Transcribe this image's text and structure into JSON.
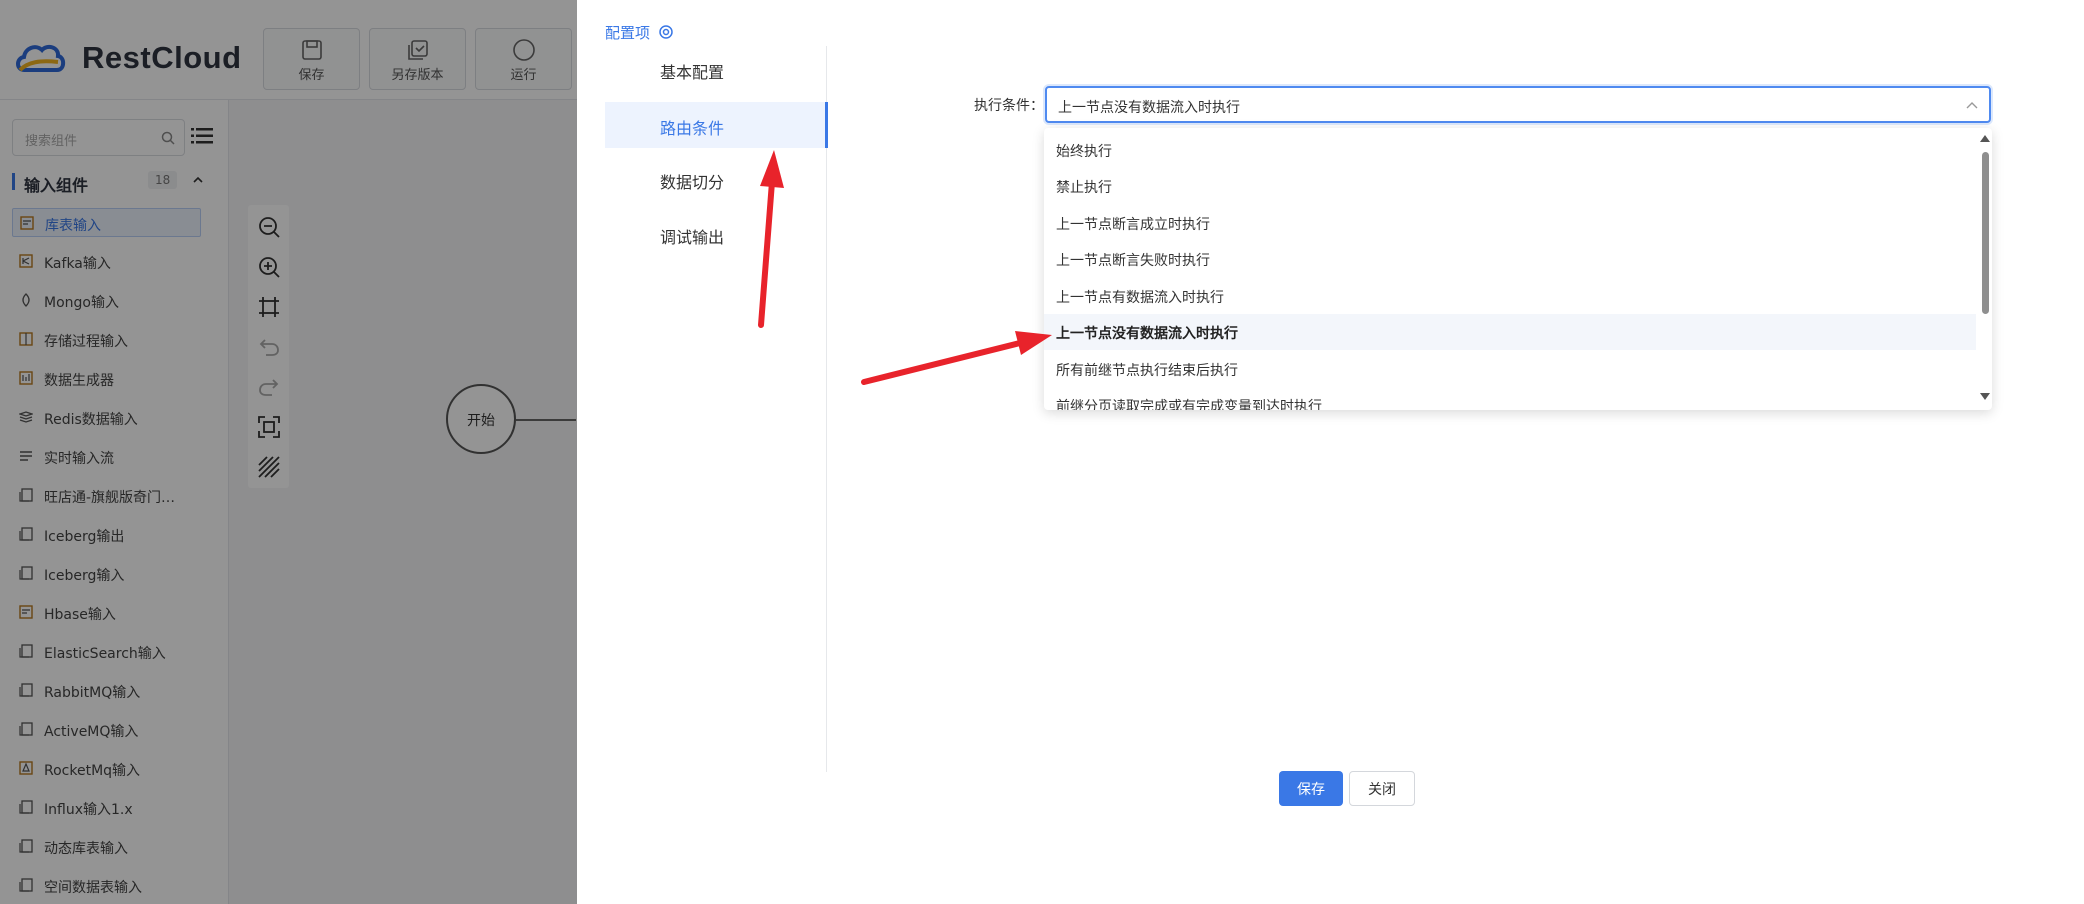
{
  "app": {
    "brand": "RestCloud",
    "toolbar": [
      {
        "label": "保存",
        "icon": "save-icon"
      },
      {
        "label": "另存版本",
        "icon": "save-version-icon"
      },
      {
        "label": "运行",
        "icon": "run-icon"
      }
    ],
    "search_placeholder": "搜索组件",
    "group": {
      "title": "输入组件",
      "count": "18"
    },
    "components": [
      "库表输入",
      "Kafka输入",
      "Mongo输入",
      "存储过程输入",
      "数据生成器",
      "Redis数据输入",
      "实时输入流",
      "旺店通-旗舰版奇门…",
      "Iceberg输出",
      "Iceberg输入",
      "Hbase输入",
      "ElasticSearch输入",
      "RabbitMQ输入",
      "ActiveMQ输入",
      "RocketMq输入",
      "Influx输入1.x",
      "动态库表输入",
      "空间数据表输入"
    ],
    "start_node": "开始"
  },
  "drawer": {
    "title": "配置项",
    "tabs": [
      "基本配置",
      "路由条件",
      "数据切分",
      "调试输出"
    ],
    "active_tab": "路由条件",
    "field_label": "执行条件：",
    "select_value": "上一节点没有数据流入时执行",
    "options": [
      "始终执行",
      "禁止执行",
      "上一节点断言成立时执行",
      "上一节点断言失败时执行",
      "上一节点有数据流入时执行",
      "上一节点没有数据流入时执行",
      "所有前继节点执行结束后执行",
      "前继分页读取完成或有完成变量到达时执行"
    ],
    "save_label": "保存",
    "close_label": "关闭"
  },
  "colors": {
    "accent": "#3a78e6",
    "arrow": "#e8232b"
  }
}
